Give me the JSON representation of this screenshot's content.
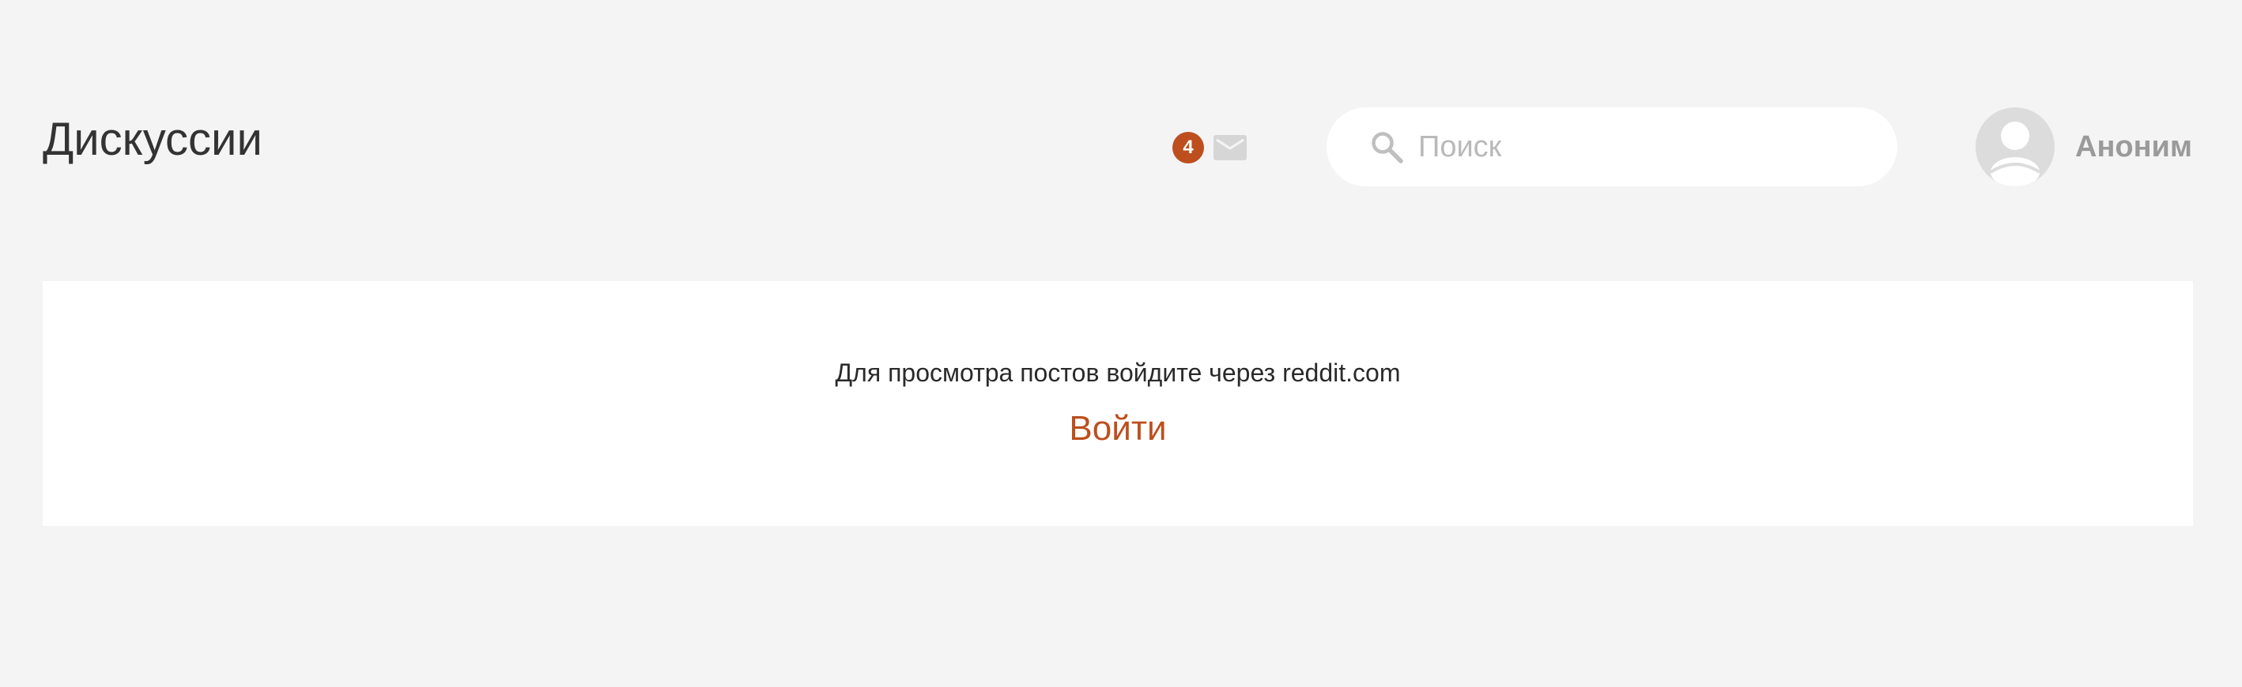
{
  "header": {
    "title": "Дискуссии",
    "notifications": {
      "count": "4",
      "badge_color": "#bd4f1e",
      "icon": "mail-icon"
    },
    "search": {
      "placeholder": "Поиск",
      "value": "",
      "icon": "search-icon"
    },
    "user": {
      "name": "Аноним",
      "avatar_icon": "avatar-icon"
    }
  },
  "main": {
    "message": "Для просмотра постов войдите через reddit.com",
    "login_label": "Войти"
  },
  "colors": {
    "accent": "#bd4f1e",
    "background": "#f4f4f4",
    "panel": "#ffffff",
    "icon_gray": "#d6d6d6"
  }
}
